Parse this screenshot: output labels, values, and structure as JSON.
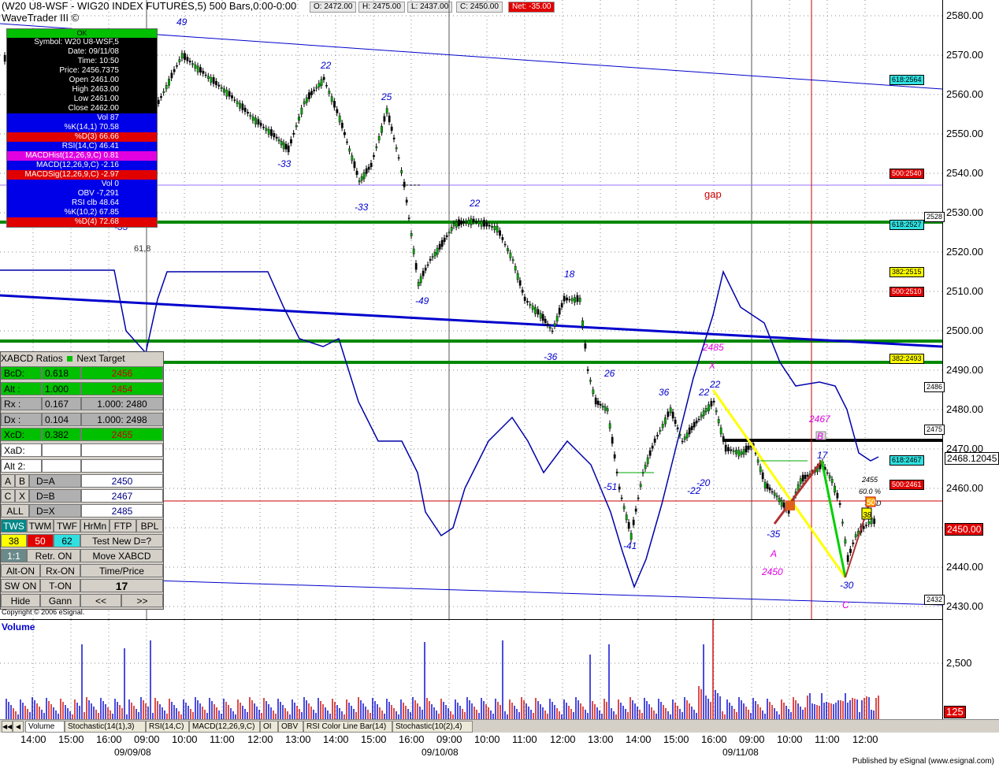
{
  "header": {
    "title": "(W20 U8-WSF - WIG20 INDEX FUTURES,5) 500 Bars,0:00-0:00",
    "ohlc": [
      {
        "label": "O: 2472.00",
        "kind": "normal"
      },
      {
        "label": "H: 2475.00",
        "kind": "normal"
      },
      {
        "label": "L: 2437.00",
        "kind": "normal"
      },
      {
        "label": "C: 2450.00",
        "kind": "normal"
      },
      {
        "label": "Net: -35.00",
        "kind": "net"
      }
    ],
    "brand": "WaveTrader III ©"
  },
  "data_window": {
    "status": "OK",
    "rows": [
      {
        "text": "Symbol: W20 U8-WSF,5",
        "style": "k"
      },
      {
        "text": "Date: 09/11/08",
        "style": "k"
      },
      {
        "text": "Time: 10:50",
        "style": "k"
      },
      {
        "text": "Price: 2456.7375",
        "style": "k"
      },
      {
        "text": "Open 2461.00",
        "style": "k"
      },
      {
        "text": "High 2463.00",
        "style": "k"
      },
      {
        "text": "Low 2461.00",
        "style": "k"
      },
      {
        "text": "Close 2462.00",
        "style": "k"
      },
      {
        "text": "Vol 87",
        "style": "bl"
      },
      {
        "text": "%K(14,1) 70.58",
        "style": "bl"
      },
      {
        "text": "%D(3) 66.66",
        "style": "rd"
      },
      {
        "text": "RSI(14,C) 46.41",
        "style": "bl"
      },
      {
        "text": "MACDHist(12,26,9,C) 0.81",
        "style": "mg"
      },
      {
        "text": "MACD(12,26,9,C) -2.16",
        "style": "bl"
      },
      {
        "text": "MACDSig(12,26,9,C) -2.97",
        "style": "rd"
      },
      {
        "text": "Vol 0",
        "style": "bl"
      },
      {
        "text": "OBV -7,291",
        "style": "bl"
      },
      {
        "text": "RSI clb 48.64",
        "style": "bl"
      },
      {
        "text": "%K(10,2) 67.85",
        "style": "bl"
      },
      {
        "text": "%D(4) 72.68",
        "style": "rd"
      }
    ]
  },
  "price_axis": {
    "labels": [
      "2580.00",
      "2570.00",
      "2560.00",
      "2550.00",
      "2540.00",
      "2530.00",
      "2520.00",
      "2510.00",
      "2500.00",
      "2490.00",
      "2480.00",
      "2470.00",
      "2460.00",
      "2450.00",
      "2440.00",
      "2430.00"
    ],
    "tags": [
      {
        "text": "618:2564",
        "color": "#30e0e0"
      },
      {
        "text": "500:2540",
        "color": "#e00000"
      },
      {
        "text": "2528",
        "color": "#ffffff"
      },
      {
        "text": "618:2527",
        "color": "#30e0e0"
      },
      {
        "text": "382:2515",
        "color": "#ffff00"
      },
      {
        "text": "500:2510",
        "color": "#e00000"
      },
      {
        "text": "382:2493",
        "color": "#ffff00"
      },
      {
        "text": "2486",
        "color": "#ffffff"
      },
      {
        "text": "2475",
        "color": "#ffffff"
      },
      {
        "text": "618:2467",
        "color": "#30e0e0"
      },
      {
        "text": "2468.12045",
        "color": "#ffffff"
      },
      {
        "text": "500:2461",
        "color": "#e00000"
      },
      {
        "text": "2450.00",
        "color": "#e00000"
      },
      {
        "text": "2432",
        "color": "#ffffff"
      }
    ]
  },
  "annotations": {
    "wave_counts": [
      "49",
      "22",
      "25",
      "-33",
      "-33",
      "-33",
      "22",
      "-49",
      "18",
      "-36",
      "26",
      "36",
      "22",
      "22",
      "-51",
      "-41",
      "-22",
      "-20",
      "-35",
      "17",
      "-30"
    ],
    "fib_note": "61,8",
    "gap": "gap",
    "pattern": {
      "x_price": "2485",
      "x": "X",
      "b_price": "2467",
      "b": "B",
      "a": "A",
      "a_price": "2450",
      "c": "C",
      "d_price": "2455",
      "d_pct": "60.0 %",
      "d_marker": "D",
      "box1": "38",
      "box2": "50"
    }
  },
  "xabcd_panel": {
    "title": "XABCD Ratios",
    "next_target": "Next Target",
    "ratios": [
      {
        "label": "BcD:",
        "value": "0.618",
        "target": "2456",
        "style": "green"
      },
      {
        "label": "Alt  :",
        "value": "1.000",
        "target": "2454",
        "style": "green"
      },
      {
        "label": "Rx   :",
        "value": "0.167",
        "target": "1.000: 2480",
        "style": "grey"
      },
      {
        "label": "Dx   :",
        "value": "0.104",
        "target": "1.000: 2498",
        "style": "grey"
      },
      {
        "label": "XcD:",
        "value": "0.382",
        "target": "2455",
        "style": "green"
      },
      {
        "label": "XaD:",
        "value": "",
        "target": "",
        "style": "white"
      },
      {
        "label": "Alt 2:",
        "value": "",
        "target": "",
        "style": "white"
      }
    ],
    "dpoints": [
      {
        "a": "A",
        "b": "B",
        "eq": "D=A",
        "val": "2450"
      },
      {
        "a": "C",
        "b": "X",
        "eq": "D=B",
        "val": "2467"
      },
      {
        "a": "ALL",
        "b": "",
        "eq": "D=X",
        "val": "2485"
      }
    ],
    "mode_buttons": [
      "TWS",
      "TWM",
      "TWF",
      "HrMn",
      "FTP",
      "BPL"
    ],
    "levels": [
      "38",
      "50",
      "62"
    ],
    "test_new": "Test New D=?",
    "ratio_btn": "1:1",
    "retr": "Retr. ON",
    "move": "Move XABCD",
    "alt_on": "Alt-ON",
    "rx_on": "Rx-ON",
    "time_price": "Time/Price",
    "sw_on": "SW ON",
    "t_on": "T-ON",
    "count": "17",
    "hide": "Hide",
    "gann": "Gann",
    "prev": "<<",
    "next": ">>"
  },
  "copyright": "Copyright © 2006 eSignal.",
  "volume_pane": {
    "title": "Volume",
    "axis": "2,500",
    "last": "125"
  },
  "tabs": [
    "Volume",
    "Stochastic(14(1),3)",
    "RSI(14,C)",
    "MACD(12,26,9,C)",
    "OI",
    "OBV",
    "RSI Color Line Bar(14)",
    "Stochastic(10(2),4)"
  ],
  "time_axis": {
    "times": [
      "14:00",
      "15:00",
      "16:00",
      "09:00",
      "10:00",
      "11:00",
      "12:00",
      "13:00",
      "14:00",
      "15:00",
      "16:00",
      "09:00",
      "10:00",
      "11:00",
      "12:00",
      "13:00",
      "14:00",
      "15:00",
      "16:00",
      "09:00",
      "10:00",
      "11:00",
      "12:00"
    ],
    "dates": [
      "09/09/08",
      "09/10/08",
      "09/11/08"
    ],
    "published": "Published by eSignal (www.esignal.com)"
  }
}
